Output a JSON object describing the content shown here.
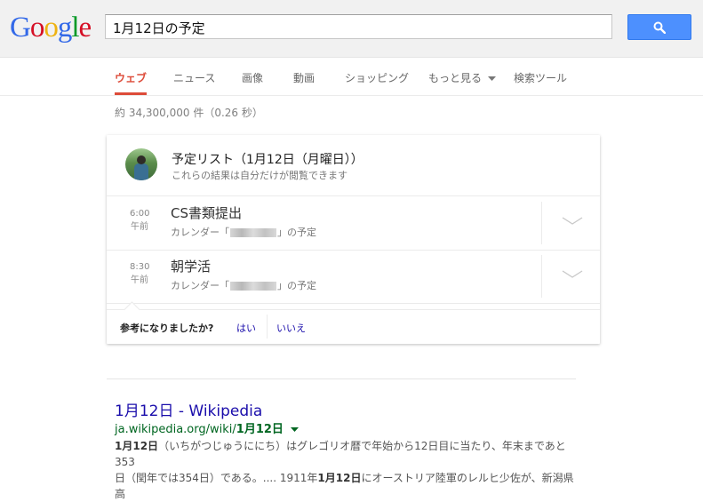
{
  "header": {
    "logo_letters": [
      {
        "char": "G",
        "color": "#3369e8"
      },
      {
        "char": "o",
        "color": "#d50f25"
      },
      {
        "char": "o",
        "color": "#eeb211"
      },
      {
        "char": "g",
        "color": "#3369e8"
      },
      {
        "char": "l",
        "color": "#009925"
      },
      {
        "char": "e",
        "color": "#d50f25"
      }
    ],
    "search_value": "1月12日の予定",
    "search_icon": "magnifier-icon"
  },
  "tabs": [
    {
      "label": "ウェブ",
      "active": true
    },
    {
      "label": "ニュース",
      "active": false
    },
    {
      "label": "画像",
      "active": false
    },
    {
      "label": "動画",
      "active": false
    },
    {
      "label": "ショッピング",
      "active": false
    },
    {
      "label": "もっと見る",
      "active": false
    },
    {
      "label": "検索ツール",
      "active": false
    }
  ],
  "result_stats": "約 34,300,000 件（0.26 秒）",
  "card": {
    "title": "予定リスト（1月12日（月曜日））",
    "subtitle": "これらの結果は自分だけが閲覧できます",
    "events": [
      {
        "time": "6:00",
        "period": "午前",
        "title": "CS書類提出",
        "cal_prefix": "カレンダー「",
        "cal_suffix": "」の予定"
      },
      {
        "time": "8:30",
        "period": "午前",
        "title": "朝学活",
        "cal_prefix": "カレンダー「",
        "cal_suffix": "」の予定"
      }
    ],
    "feedback": {
      "question": "参考になりましたか?",
      "yes": "はい",
      "no": "いいえ"
    }
  },
  "result": {
    "title": "1月12日 - Wikipedia",
    "url_prefix": "ja.wikipedia.org/wiki/",
    "url_bold": "1月12日",
    "snippet_lines": [
      {
        "bold": "1月12日",
        "text": "（いちがつじゅうににち）はグレゴリオ暦で年始から12日目に当たり、年末まであと353"
      },
      {
        "text_a": "日（閏年では354日）である。.... 1911年",
        "bold": "1月12日",
        "text_b": "にオーストリア陸軍のレルヒ少佐が、新潟県高"
      }
    ]
  },
  "colors": {
    "accent_red": "#dd4b39",
    "search_blue": "#4d90fe",
    "link_blue": "#1a0dab",
    "url_green": "#006621"
  }
}
